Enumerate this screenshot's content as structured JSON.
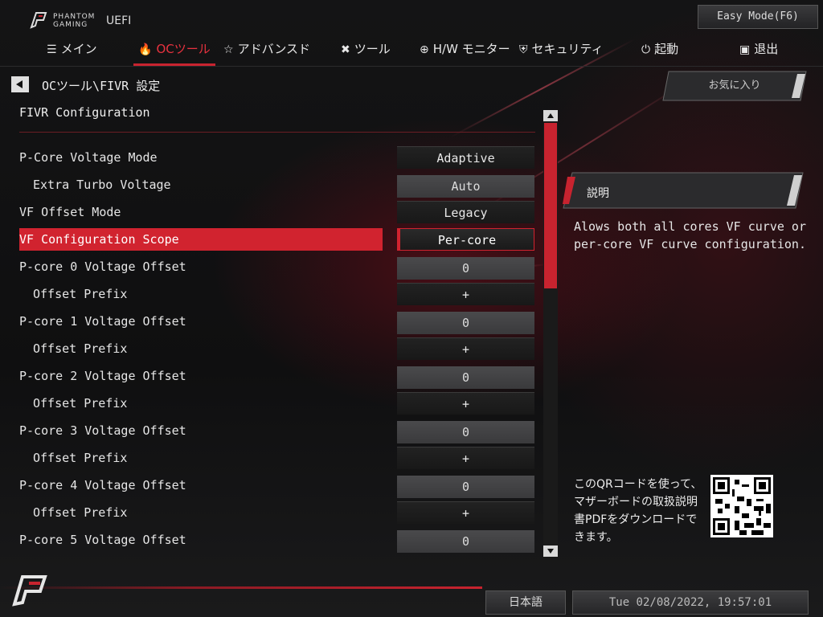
{
  "brand": {
    "line1": "PHANTOM",
    "line2": "GAMING",
    "uefi": "UEFI"
  },
  "easy_mode_label": "Easy Mode(F6)",
  "tabs": [
    {
      "label": "メイン",
      "icon": "list-icon"
    },
    {
      "label": "OCツール",
      "icon": "flame-icon",
      "active": true
    },
    {
      "label": "アドバンスド",
      "icon": "star-icon"
    },
    {
      "label": "ツール",
      "icon": "tools-icon"
    },
    {
      "label": "H/W モニター",
      "icon": "crosshair-icon"
    },
    {
      "label": "セキュリティ",
      "icon": "shield-icon"
    },
    {
      "label": "起動",
      "icon": "power-icon"
    },
    {
      "label": "退出",
      "icon": "exit-icon"
    }
  ],
  "breadcrumb": "OCツール\\FIVR 設定",
  "section_title": "FIVR Configuration",
  "rows": [
    {
      "label": "P-Core Voltage Mode",
      "value": "Adaptive",
      "indent": false,
      "style": "dark"
    },
    {
      "label": "Extra Turbo Voltage",
      "value": "Auto",
      "indent": true,
      "style": "light"
    },
    {
      "label": "VF Offset Mode",
      "value": "Legacy",
      "indent": false,
      "style": "dark"
    },
    {
      "label": "VF Configuration Scope",
      "value": "Per-core",
      "indent": false,
      "style": "sel",
      "selected": true
    },
    {
      "label": "P-core 0 Voltage Offset",
      "value": "0",
      "indent": false,
      "style": "light"
    },
    {
      "label": "Offset Prefix",
      "value": "+",
      "indent": true,
      "style": "dark"
    },
    {
      "label": "P-core 1 Voltage Offset",
      "value": "0",
      "indent": false,
      "style": "light"
    },
    {
      "label": "Offset Prefix",
      "value": "+",
      "indent": true,
      "style": "dark"
    },
    {
      "label": "P-core 2 Voltage Offset",
      "value": "0",
      "indent": false,
      "style": "light"
    },
    {
      "label": "Offset Prefix",
      "value": "+",
      "indent": true,
      "style": "dark"
    },
    {
      "label": "P-core 3 Voltage Offset",
      "value": "0",
      "indent": false,
      "style": "light"
    },
    {
      "label": "Offset Prefix",
      "value": "+",
      "indent": true,
      "style": "dark"
    },
    {
      "label": "P-core 4 Voltage Offset",
      "value": "0",
      "indent": false,
      "style": "light"
    },
    {
      "label": "Offset Prefix",
      "value": "+",
      "indent": true,
      "style": "dark"
    },
    {
      "label": "P-core 5 Voltage Offset",
      "value": "0",
      "indent": false,
      "style": "light"
    }
  ],
  "favorites_label": "お気に入り",
  "description": {
    "title": "説明",
    "text": "Alows both all cores VF curve or per-core VF curve configuration."
  },
  "qr_caption": "このQRコードを使って、マザーボードの取扱説明書PDFをダウンロードできます。",
  "language": "日本語",
  "datetime": "Tue 02/08/2022, 19:57:01",
  "colors": {
    "accent": "#d1232f",
    "background": "#0d0d0e",
    "text": "#e6e6e6"
  }
}
